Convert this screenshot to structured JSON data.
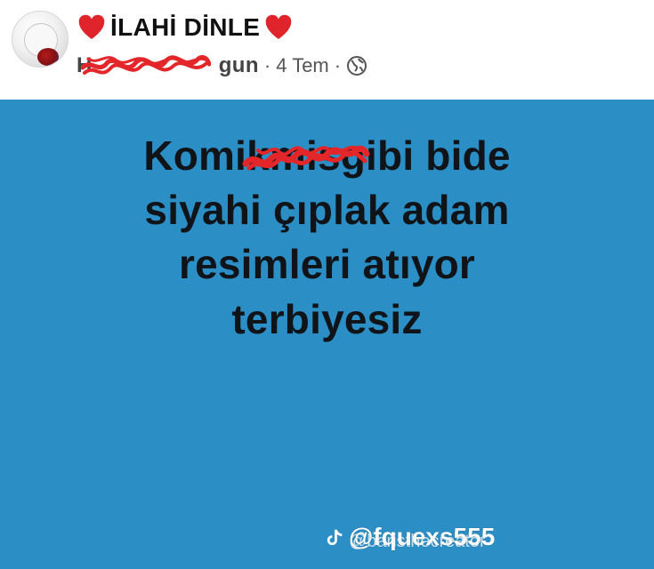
{
  "post": {
    "page_title": "İLAHİ DİNLE",
    "author_visible_suffix": "gun",
    "author_visible_prefix": "H",
    "separator": "·",
    "date": "4 Tem"
  },
  "content": {
    "lines": [
      "Komikmisgibi bide",
      "siyahi çıplak adam",
      "resimleri atıyor",
      "terbiyesiz"
    ]
  },
  "watermark": {
    "primary_handle": "@fquexs555",
    "secondary_handle": "@baristhecreator"
  },
  "colors": {
    "panel_blue": "#2b8ec5",
    "heart_red": "#e0242b",
    "redaction_red": "#e3262a"
  },
  "icons": {
    "title_left": "heart-icon",
    "title_right": "heart-icon",
    "privacy": "globe-icon",
    "watermark": "tiktok-icon"
  }
}
